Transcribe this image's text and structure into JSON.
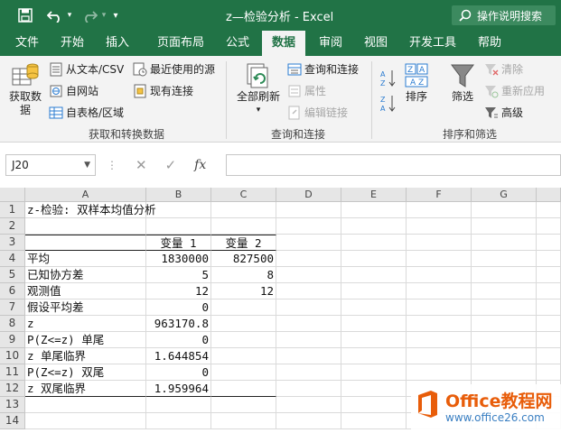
{
  "window": {
    "title": "z—检验分析  -  Excel",
    "help_search": "操作说明搜索"
  },
  "tabs": [
    "文件",
    "开始",
    "插入",
    "页面布局",
    "公式",
    "数据",
    "审阅",
    "视图",
    "开发工具",
    "帮助"
  ],
  "active_tab": "数据",
  "ribbon": {
    "get_data": "获取数\n据",
    "from_text_csv": "从文本/CSV",
    "from_web": "自网站",
    "from_table": "自表格/区域",
    "recent_sources": "最近使用的源",
    "existing_connections": "现有连接",
    "group_get_transform": "获取和转换数据",
    "refresh_all": "全部刷新",
    "queries_connections": "查询和连接",
    "properties": "属性",
    "edit_links": "编辑链接",
    "group_queries": "查询和连接",
    "sort": "排序",
    "filter": "筛选",
    "clear": "清除",
    "reapply": "重新应用",
    "advanced": "高级",
    "group_sort_filter": "排序和筛选"
  },
  "formula_bar": {
    "name_box": "J20",
    "fx": "fx",
    "formula": ""
  },
  "columns": [
    "A",
    "B",
    "C",
    "D",
    "E",
    "F",
    "G"
  ],
  "rows": [
    "1",
    "2",
    "3",
    "4",
    "5",
    "6",
    "7",
    "8",
    "9",
    "10",
    "11",
    "12",
    "13",
    "14"
  ],
  "cells": {
    "A1": "z-检验: 双样本均值分析",
    "B3": "变量 1",
    "C3": "变量 2",
    "A4": "平均",
    "B4": "1830000",
    "C4": "827500",
    "A5": "已知协方差",
    "B5": "5",
    "C5": "8",
    "A6": "观测值",
    "B6": "12",
    "C6": "12",
    "A7": "假设平均差",
    "B7": "0",
    "A8": "z",
    "B8": "963170.8",
    "A9": "P(Z<=z) 单尾",
    "B9": "0",
    "A10": "z 单尾临界",
    "B10": "1.644854",
    "A11": "P(Z<=z) 双尾",
    "B11": "0",
    "A12": "z 双尾临界",
    "B12": "1.959964"
  },
  "watermark": {
    "title": "Office教程网",
    "url": "www.office26.com"
  },
  "colors": {
    "excel_green": "#217346",
    "ribbon_bg": "#f3f3f3",
    "header_bg": "#e6e6e6",
    "watermark_orange": "#e85d0a"
  }
}
